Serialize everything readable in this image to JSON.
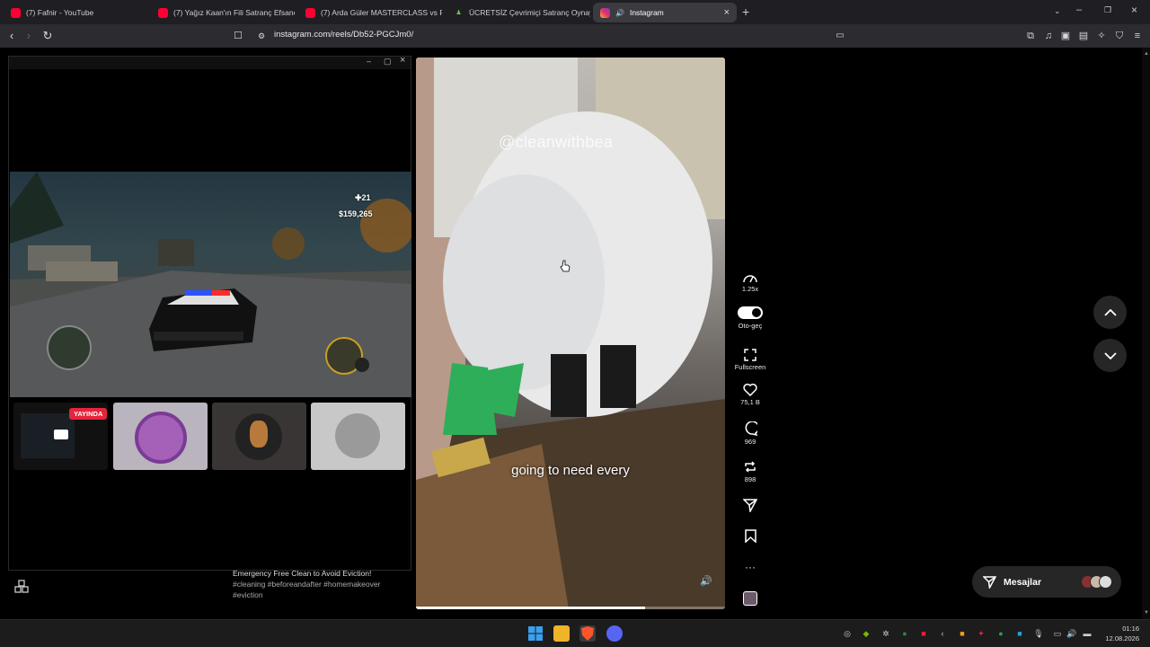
{
  "tabs": [
    {
      "title": "(7) Fafnir - YouTube",
      "favicon": "youtube-icon"
    },
    {
      "title": "(7) Yağız Kaan'ın Fili Satranç Efsanesi",
      "favicon": "youtube-icon"
    },
    {
      "title": "(7) Arda Güler MASTERCLASS vs Fenerbahçe",
      "favicon": "youtube-icon"
    },
    {
      "title": "ÜCRETSİZ Çevrimiçi Satranç Oynayın",
      "favicon": "chess-pawn-icon"
    },
    {
      "title": "Instagram",
      "favicon": "instagram-icon",
      "active": true
    }
  ],
  "address_bar": {
    "url": "instagram.com/reels/Db52-PGCJm0/"
  },
  "game": {
    "money": "$159,265",
    "ammo": "21"
  },
  "live_badge": "YAYINDA",
  "reel": {
    "watermark": "@cleanwithbea",
    "subtitle": "going to need every",
    "progress": 0.74,
    "description": {
      "title": "Emergency Free Clean to Avoid Eviction!",
      "tags": "#cleaning #beforeandafter #homemakeover #eviction"
    }
  },
  "actions": {
    "speed": "1.25x",
    "autoplay": "Oto-geç",
    "fullscreen": "Fullscreen",
    "likes": "75,1 B",
    "comments": "969",
    "reposts": "898"
  },
  "messages": {
    "label": "Mesajlar"
  },
  "clock": {
    "time": "01:16",
    "date": "12.08.2026"
  },
  "colors": {
    "accent_ig": "#e1306c",
    "live": "#e5243b",
    "taskbar": "#1c1c1c"
  }
}
